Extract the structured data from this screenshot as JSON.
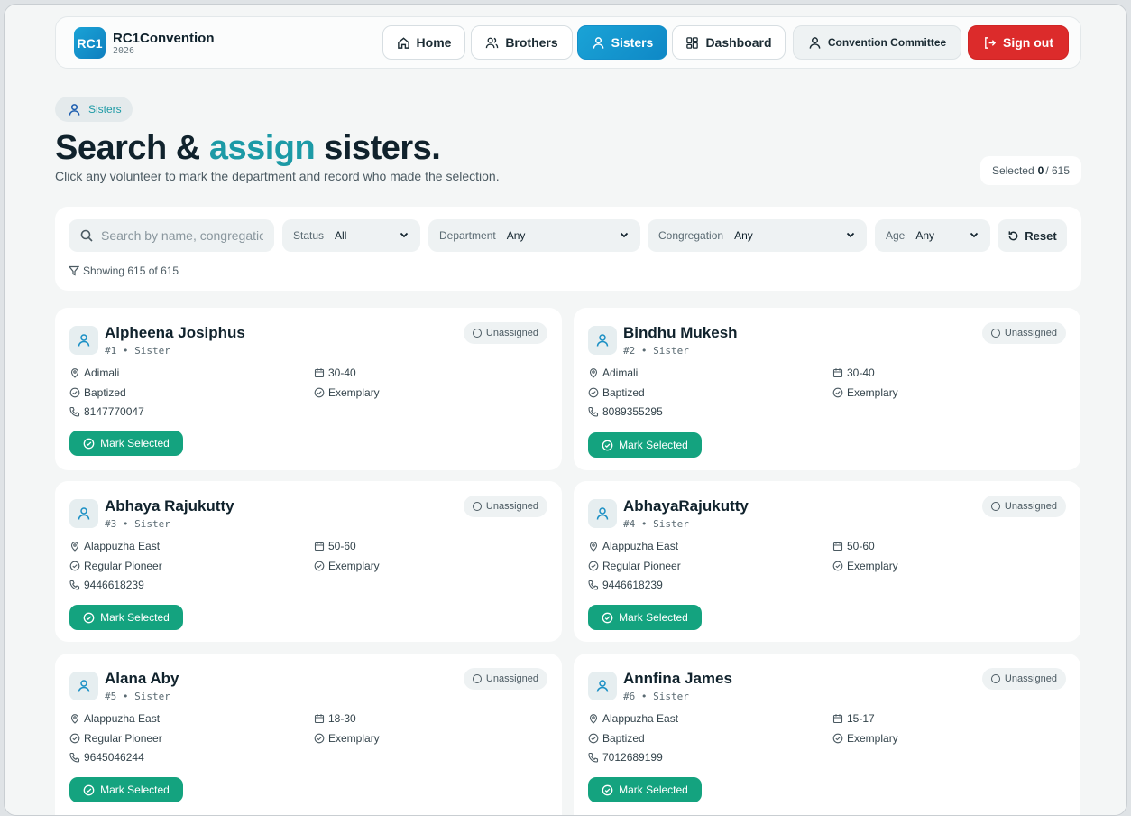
{
  "brand": {
    "logo": "RC1",
    "name": "RC1Convention",
    "year": "2026"
  },
  "nav": {
    "home": "Home",
    "brothers": "Brothers",
    "sisters": "Sisters",
    "dashboard": "Dashboard",
    "committee": "Convention Committee",
    "signout": "Sign out"
  },
  "header": {
    "pill": "Sisters",
    "title_a": "Search & ",
    "title_accent": "assign",
    "title_b": " sisters.",
    "subtitle": "Click any volunteer to mark the department and record who made the selection.",
    "selected_label": "Selected",
    "selected_count": "0",
    "selected_total": "/ 615"
  },
  "filters": {
    "search_placeholder": "Search by name, congregation",
    "status_label": "Status",
    "status_value": "All",
    "department_label": "Department",
    "department_value": "Any",
    "congregation_label": "Congregation",
    "congregation_value": "Any",
    "age_label": "Age",
    "age_value": "Any",
    "reset": "Reset",
    "showing": "Showing 615 of 615"
  },
  "cards": [
    {
      "name": "Alpheena Josiphus",
      "meta": "#1 • Sister",
      "badge": "Unassigned",
      "location": "Adimali",
      "age": "30-40",
      "status": "Baptized",
      "conduct": "Exemplary",
      "phone": "8147770047",
      "action": "Mark Selected"
    },
    {
      "name": "Bindhu Mukesh",
      "meta": "#2 • Sister",
      "badge": "Unassigned",
      "location": "Adimali",
      "age": "30-40",
      "status": "Baptized",
      "conduct": "Exemplary",
      "phone": "8089355295",
      "action": "Mark Selected"
    },
    {
      "name": "Abhaya Rajukutty",
      "meta": "#3 • Sister",
      "badge": "Unassigned",
      "location": "Alappuzha East",
      "age": "50-60",
      "status": "Regular Pioneer",
      "conduct": "Exemplary",
      "phone": "9446618239",
      "action": "Mark Selected"
    },
    {
      "name": "AbhayaRajukutty",
      "meta": "#4 • Sister",
      "badge": "Unassigned",
      "location": "Alappuzha East",
      "age": "50-60",
      "status": "Regular Pioneer",
      "conduct": "Exemplary",
      "phone": "9446618239",
      "action": "Mark Selected"
    },
    {
      "name": "Alana Aby",
      "meta": "#5 • Sister",
      "badge": "Unassigned",
      "location": "Alappuzha East",
      "age": "18-30",
      "status": "Regular Pioneer",
      "conduct": "Exemplary",
      "phone": "9645046244",
      "action": "Mark Selected"
    },
    {
      "name": "Annfina James",
      "meta": "#6 • Sister",
      "badge": "Unassigned",
      "location": "Alappuzha East",
      "age": "15-17",
      "status": "Baptized",
      "conduct": "Exemplary",
      "phone": "7012689199",
      "action": "Mark Selected"
    }
  ]
}
